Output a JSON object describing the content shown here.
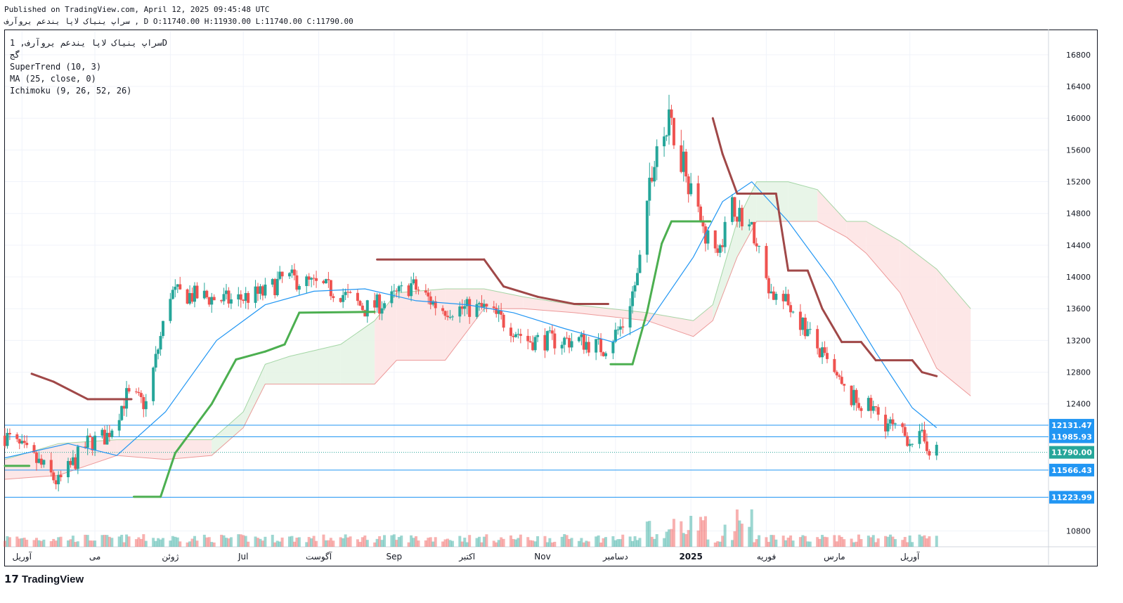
{
  "header": {
    "published": "Published on TradingView.com, April 12, 2025 09:45:48 UTC",
    "ohlc": "سراپ ینیاک لاپا یندعم یروآرف , D O:11740.00 H:11930.00 L:11740.00 C:11790.00"
  },
  "legend": {
    "symbol": "سراپ ینیاک لاپا یندعم یروآرف, 1D",
    "exchange": "گج",
    "supertrend": "SuperTrend (10, 3)",
    "ma": "MA (25, close, 0)",
    "ichimoku": "Ichimoku (9, 26, 52, 26)"
  },
  "branding": {
    "logo": "TradingView"
  },
  "colors": {
    "up": "#26a69a",
    "down": "#ef5350",
    "supertrend_up": "#4caf50",
    "supertrend_down": "#a04848",
    "ma": "#2196f3",
    "cloud_bull": "#e6f4e6",
    "cloud_bear": "#fde4e4",
    "hline": "#2196f3",
    "last_price": "#26a69a"
  },
  "chart_data": {
    "type": "candlestick",
    "timeframe": "1D",
    "ylim": [
      10600,
      17100
    ],
    "y_ticks": [
      10800,
      12400,
      12800,
      13200,
      13600,
      14000,
      14400,
      14800,
      15200,
      15600,
      16000,
      16400,
      16800
    ],
    "x_labels": [
      {
        "label": "آوریل",
        "date": "2024-04-01"
      },
      {
        "label": "می",
        "date": "2024-05-01"
      },
      {
        "label": "ژوئن",
        "date": "2024-06-01"
      },
      {
        "label": "Jul",
        "date": "2024-07-01"
      },
      {
        "label": "آگوست",
        "date": "2024-08-01"
      },
      {
        "label": "Sep",
        "date": "2024-09-01"
      },
      {
        "label": "اکتبر",
        "date": "2024-10-01"
      },
      {
        "label": "Nov",
        "date": "2024-11-01"
      },
      {
        "label": "دسامبر",
        "date": "2024-12-01"
      },
      {
        "label": "2025",
        "date": "2025-01-01"
      },
      {
        "label": "فوریه",
        "date": "2025-02-01"
      },
      {
        "label": "مارس",
        "date": "2025-03-01"
      },
      {
        "label": "آوریل",
        "date": "2025-04-01"
      }
    ],
    "price_path": [
      [
        "2024-03-25",
        12000
      ],
      [
        "2024-04-08",
        11650
      ],
      [
        "2024-04-16",
        11400
      ],
      [
        "2024-04-28",
        11900
      ],
      [
        "2024-05-06",
        12000
      ],
      [
        "2024-05-14",
        12500
      ],
      [
        "2024-05-22",
        12400
      ],
      [
        "2024-06-01",
        13800
      ],
      [
        "2024-06-14",
        13750
      ],
      [
        "2024-06-26",
        13700
      ],
      [
        "2024-07-10",
        13800
      ],
      [
        "2024-07-18",
        14000
      ],
      [
        "2024-07-30",
        13900
      ],
      [
        "2024-08-10",
        13800
      ],
      [
        "2024-08-20",
        13600
      ],
      [
        "2024-08-30",
        13700
      ],
      [
        "2024-09-08",
        13900
      ],
      [
        "2024-09-20",
        13600
      ],
      [
        "2024-09-30",
        13600
      ],
      [
        "2024-10-08",
        13600
      ],
      [
        "2024-10-18",
        13400
      ],
      [
        "2024-10-26",
        13200
      ],
      [
        "2024-11-06",
        13200
      ],
      [
        "2024-11-16",
        13200
      ],
      [
        "2024-11-26",
        13100
      ],
      [
        "2024-12-04",
        13400
      ],
      [
        "2024-12-10",
        14000
      ],
      [
        "2024-12-18",
        15700
      ],
      [
        "2024-12-24",
        15900
      ],
      [
        "2024-12-30",
        15400
      ],
      [
        "2025-01-06",
        14600
      ],
      [
        "2025-01-12",
        14300
      ],
      [
        "2025-01-18",
        14900
      ],
      [
        "2025-01-26",
        14600
      ],
      [
        "2025-02-03",
        13800
      ],
      [
        "2025-02-12",
        13600
      ],
      [
        "2025-02-22",
        13100
      ],
      [
        "2025-03-06",
        12500
      ],
      [
        "2025-03-18",
        12300
      ],
      [
        "2025-03-28",
        12000
      ],
      [
        "2025-04-06",
        11950
      ],
      [
        "2025-04-12",
        11790
      ]
    ],
    "supertrend": [
      [
        "2024-03-25",
        11620,
        "up"
      ],
      [
        "2024-04-04",
        11620,
        "up"
      ],
      [
        "2024-04-05",
        12780,
        "down"
      ],
      [
        "2024-04-14",
        12680,
        "down"
      ],
      [
        "2024-04-28",
        12460,
        "down"
      ],
      [
        "2024-05-16",
        12460,
        "down"
      ],
      [
        "2024-05-17",
        11230,
        "up"
      ],
      [
        "2024-05-28",
        11230,
        "up"
      ],
      [
        "2024-06-03",
        11780,
        "up"
      ],
      [
        "2024-06-18",
        12400,
        "up"
      ],
      [
        "2024-06-28",
        12960,
        "up"
      ],
      [
        "2024-07-10",
        13060,
        "up"
      ],
      [
        "2024-07-18",
        13150,
        "up"
      ],
      [
        "2024-07-24",
        13550,
        "up"
      ],
      [
        "2024-08-24",
        13560,
        "up"
      ],
      [
        "2024-08-25",
        14220,
        "down"
      ],
      [
        "2024-10-08",
        14220,
        "down"
      ],
      [
        "2024-10-16",
        13880,
        "down"
      ],
      [
        "2024-10-30",
        13750,
        "down"
      ],
      [
        "2024-11-14",
        13660,
        "down"
      ],
      [
        "2024-11-28",
        13660,
        "down"
      ],
      [
        "2024-11-29",
        12900,
        "up"
      ],
      [
        "2024-12-08",
        12900,
        "up"
      ],
      [
        "2024-12-14",
        13560,
        "up"
      ],
      [
        "2024-12-20",
        14420,
        "up"
      ],
      [
        "2024-12-24",
        14700,
        "up"
      ],
      [
        "2025-01-09",
        14700,
        "up"
      ],
      [
        "2025-01-10",
        16000,
        "down"
      ],
      [
        "2025-01-14",
        15550,
        "down"
      ],
      [
        "2025-01-20",
        15050,
        "down"
      ],
      [
        "2025-02-05",
        15050,
        "down"
      ],
      [
        "2025-02-10",
        14080,
        "down"
      ],
      [
        "2025-02-18",
        14080,
        "down"
      ],
      [
        "2025-02-24",
        13600,
        "down"
      ],
      [
        "2025-03-04",
        13180,
        "down"
      ],
      [
        "2025-03-12",
        13180,
        "down"
      ],
      [
        "2025-03-18",
        12950,
        "down"
      ],
      [
        "2025-04-02",
        12950,
        "down"
      ],
      [
        "2025-04-06",
        12800,
        "down"
      ],
      [
        "2025-04-12",
        12750,
        "down"
      ]
    ],
    "ma_25": [
      [
        "2024-03-25",
        11720
      ],
      [
        "2024-04-20",
        11900
      ],
      [
        "2024-05-10",
        11750
      ],
      [
        "2024-05-30",
        12300
      ],
      [
        "2024-06-20",
        13200
      ],
      [
        "2024-07-10",
        13650
      ],
      [
        "2024-07-30",
        13820
      ],
      [
        "2024-08-20",
        13850
      ],
      [
        "2024-09-10",
        13700
      ],
      [
        "2024-10-01",
        13650
      ],
      [
        "2024-10-20",
        13550
      ],
      [
        "2024-11-10",
        13350
      ],
      [
        "2024-11-30",
        13180
      ],
      [
        "2024-12-14",
        13400
      ],
      [
        "2025-01-02",
        14250
      ],
      [
        "2025-01-14",
        14950
      ],
      [
        "2025-01-26",
        15200
      ],
      [
        "2025-02-10",
        14700
      ],
      [
        "2025-02-28",
        13950
      ],
      [
        "2025-03-18",
        13050
      ],
      [
        "2025-04-02",
        12350
      ],
      [
        "2025-04-12",
        12100
      ]
    ],
    "ichimoku_cloud": [
      [
        "2024-03-25",
        11450,
        11700
      ],
      [
        "2024-04-16",
        11500,
        11900
      ],
      [
        "2024-05-10",
        11750,
        11950
      ],
      [
        "2024-05-30",
        11700,
        11950
      ],
      [
        "2024-06-18",
        11750,
        11950
      ],
      [
        "2024-07-01",
        12100,
        12300
      ],
      [
        "2024-07-10",
        12650,
        12900
      ],
      [
        "2024-07-20",
        12650,
        13000
      ],
      [
        "2024-08-10",
        12650,
        13150
      ],
      [
        "2024-08-24",
        12650,
        13450
      ],
      [
        "2024-09-02",
        12950,
        13800
      ],
      [
        "2024-09-22",
        12950,
        13850
      ],
      [
        "2024-10-08",
        13600,
        13850
      ],
      [
        "2024-10-24",
        13600,
        13750
      ],
      [
        "2024-11-14",
        13550,
        13650
      ],
      [
        "2024-12-14",
        13450,
        13550
      ],
      [
        "2025-01-02",
        13250,
        13450
      ],
      [
        "2025-01-10",
        13450,
        13650
      ],
      [
        "2025-01-20",
        14250,
        14700
      ],
      [
        "2025-01-28",
        14700,
        15200
      ],
      [
        "2025-02-10",
        14700,
        15200
      ],
      [
        "2025-02-22",
        14700,
        15100
      ],
      [
        "2025-03-06",
        14500,
        14700
      ],
      [
        "2025-03-14",
        14300,
        14700
      ],
      [
        "2025-03-28",
        13800,
        14450
      ],
      [
        "2025-04-12",
        12850,
        14100
      ],
      [
        "2025-04-26",
        12500,
        13600
      ]
    ],
    "horizontal_levels": [
      12131.47,
      11985.93,
      11566.43,
      11223.99
    ],
    "last_price": 11790.0,
    "ohlc_last": {
      "open": 11740.0,
      "high": 11930.0,
      "low": 11740.0,
      "close": 11790.0
    }
  }
}
